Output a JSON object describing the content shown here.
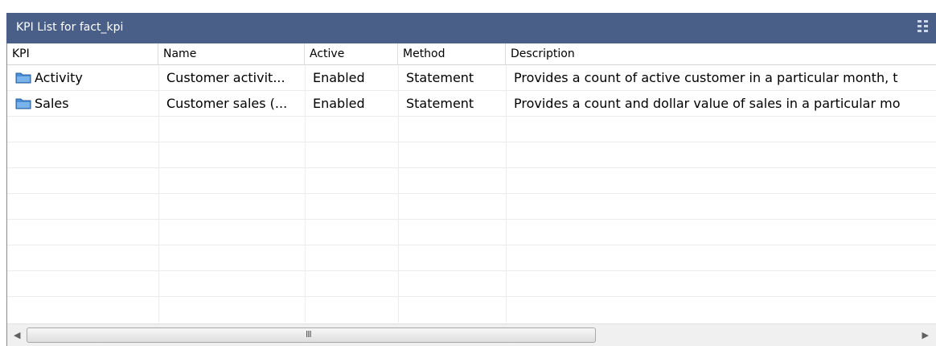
{
  "window": {
    "title": "KPI List for fact_kpi",
    "grip_icon": "grip-dots-icon"
  },
  "columns": [
    {
      "label": "KPI"
    },
    {
      "label": "Name"
    },
    {
      "label": "Active"
    },
    {
      "label": "Method"
    },
    {
      "label": "Description"
    }
  ],
  "rows": [
    {
      "kpi": "Activity",
      "name": "Customer activit...",
      "active": "Enabled",
      "method": "Statement",
      "description": "Provides a count of active customer in a particular month, t"
    },
    {
      "kpi": "Sales",
      "name": "Customer sales (...",
      "active": "Enabled",
      "method": "Statement",
      "description": "Provides a count and dollar value of sales in a particular mo"
    }
  ],
  "scrollbar": {
    "left_arrow": "◀",
    "right_arrow": "▶",
    "grip": "III"
  },
  "colors": {
    "titlebar": "#4a5f87",
    "folder": "#4a8fd8"
  }
}
